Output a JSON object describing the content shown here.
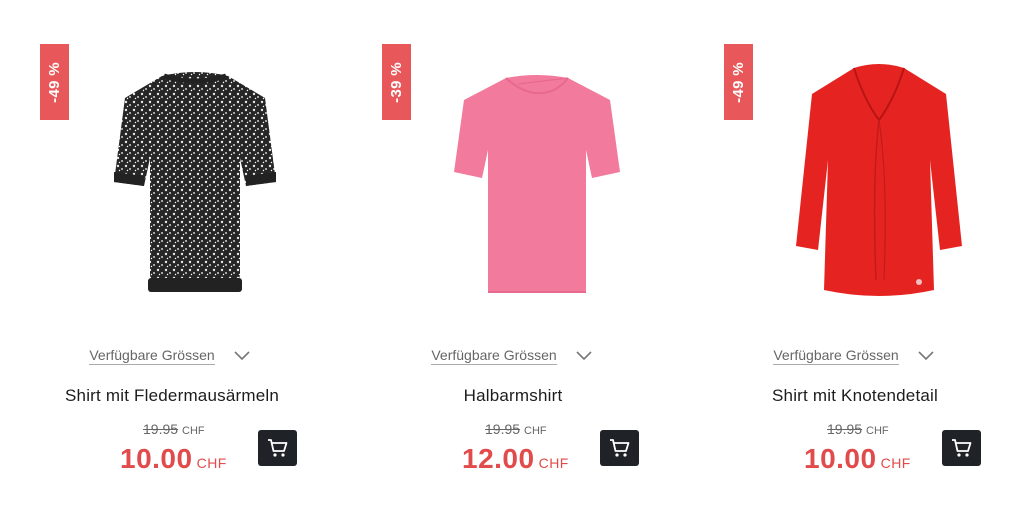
{
  "products": [
    {
      "discount": "-49 %",
      "image_icon": "shirt-black-floral-icon",
      "sizes_label": "Verfügbare Grössen",
      "name": "Shirt mit Fledermausärmeln",
      "old_price": "19.95",
      "old_currency": "CHF",
      "new_price": "10.00",
      "new_currency": "CHF",
      "cart_icon": "shopping-cart-icon",
      "color": "#2b2b2b"
    },
    {
      "discount": "-39 %",
      "image_icon": "shirt-pink-icon",
      "sizes_label": "Verfügbare Grössen",
      "name": "Halbarmshirt",
      "old_price": "19.95",
      "old_currency": "CHF",
      "new_price": "12.00",
      "new_currency": "CHF",
      "cart_icon": "shopping-cart-icon",
      "color": "#f27a9c"
    },
    {
      "discount": "-49 %",
      "image_icon": "shirt-red-icon",
      "sizes_label": "Verfügbare Grössen",
      "name": "Shirt mit Knotendetail",
      "old_price": "19.95",
      "old_currency": "CHF",
      "new_price": "10.00",
      "new_currency": "CHF",
      "cart_icon": "shopping-cart-icon",
      "color": "#e52422"
    }
  ],
  "colors": {
    "badge": "#e8585a",
    "sale_price": "#e14b4b",
    "cart_button": "#1f2327"
  }
}
